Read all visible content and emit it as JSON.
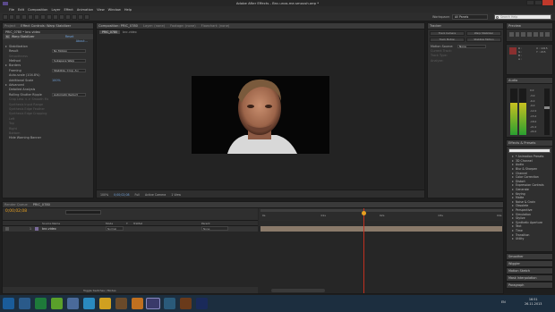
{
  "window": {
    "title": "Adobe After Effects - Bnc.unos.me.smoush.aep *"
  },
  "menu": [
    "File",
    "Edit",
    "Composition",
    "Layer",
    "Effect",
    "Animation",
    "View",
    "Window",
    "Help"
  ],
  "workspace": {
    "label": "Workspace:",
    "value": "All Panels",
    "search_placeholder": "Search Help"
  },
  "effect_controls": {
    "tab": "Effect Controls: Warp Stabilizer",
    "other_tab": "Project",
    "breadcrumb": "PRIC_0780 • bnc.video",
    "effect_name": "Warp Stabilizer",
    "reset": "Reset",
    "about": "About...",
    "rows": [
      {
        "label": "Stabilization",
        "value": "",
        "kind": "section"
      },
      {
        "label": "Result",
        "value": "No Motion",
        "kind": "dropdown"
      },
      {
        "label": "Smoothness",
        "value": "",
        "kind": "dim"
      },
      {
        "label": "Method",
        "value": "Subspace Warp",
        "kind": "dropdown"
      },
      {
        "label": "Borders",
        "value": "",
        "kind": "section"
      },
      {
        "label": "Framing",
        "value": "Stabilize, Crop, Au",
        "kind": "dropdown"
      },
      {
        "label": "Auto-scale (104.8%)",
        "value": "",
        "kind": "plain"
      },
      {
        "label": "Additional Scale",
        "value": "100%",
        "kind": "value"
      },
      {
        "label": "Advanced",
        "value": "",
        "kind": "section"
      },
      {
        "label": "Detailed Analysis",
        "value": "",
        "kind": "plain"
      },
      {
        "label": "Rolling Shutter Ripple",
        "value": "Automatic Reduct",
        "kind": "dropdown"
      },
      {
        "label": "Crop Less <-> Smooth More",
        "value": "",
        "kind": "dim"
      },
      {
        "label": "Synthesis Input Range",
        "value": "",
        "kind": "dim"
      },
      {
        "label": "Synthesis Edge Feather",
        "value": "",
        "kind": "dim"
      },
      {
        "label": "Synthesis Edge Cropping",
        "value": "",
        "kind": "dim"
      },
      {
        "label": "Left",
        "value": "",
        "kind": "dim"
      },
      {
        "label": "Top",
        "value": "",
        "kind": "dim"
      },
      {
        "label": "Right",
        "value": "",
        "kind": "dim"
      },
      {
        "label": "Bottom",
        "value": "",
        "kind": "dim"
      },
      {
        "label": "Hide Warning Banner",
        "value": "",
        "kind": "plain"
      }
    ]
  },
  "composition": {
    "tabs": [
      "Composition: PRIC_0780",
      "Layer: (none)",
      "Footage: (none)",
      "Flowchart: (none)"
    ],
    "subtabs": [
      "PRIC_0780",
      "bnc.video"
    ],
    "zoom": "100%",
    "timecode": "0;00;02;08",
    "resolution": "Full",
    "camera": "Active Camera",
    "view": "1 View"
  },
  "tracker": {
    "title": "Tracker",
    "motion_source_label": "Motion Source:",
    "motion_source": "None",
    "current_track_label": "Current Track:",
    "track_type_label": "Track Type:",
    "analyze_label": "Analyze:",
    "buttons": [
      "Track Camera",
      "Warp Stabilizer",
      "Track Motion",
      "Stabilize Motion"
    ]
  },
  "preview": {
    "title": "Preview"
  },
  "info": {
    "r": "R :",
    "g": "G :",
    "b": "B :",
    "a": "A :",
    "x": "X : 1015",
    "y": "Y : 215"
  },
  "audio": {
    "title": "Audio",
    "levels": [
      "0.0",
      "-3.0",
      "-6.0",
      "-9.0",
      "-12.0",
      "-15.0",
      "-18.0",
      "-21.0",
      "-24.0"
    ]
  },
  "effects_presets": {
    "title": "Effects & Presets",
    "search_placeholder": "",
    "items": [
      "* Animation Presets",
      "3D Channel",
      "Audio",
      "Blur & Sharpen",
      "Channel",
      "Color Correction",
      "Distort",
      "Expression Controls",
      "Generate",
      "Keying",
      "Matte",
      "Noise & Grain",
      "Obsolete",
      "Perspective",
      "Simulation",
      "Stylize",
      "Synthetic Aperture",
      "Text",
      "Time",
      "Transition",
      "Utility"
    ],
    "collapsed_panels": [
      "Smoother",
      "Wiggler",
      "Motion Sketch",
      "Mask Interpolation",
      "Paragraph"
    ]
  },
  "timeline": {
    "tabs": [
      "Render Queue",
      "PRIC_0780"
    ],
    "timecode": "0;00;02;08",
    "columns": [
      "Source Name",
      "Mode",
      "T",
      "TrkMat",
      "Parent"
    ],
    "layer": {
      "index": "1",
      "name": "bnc.video",
      "mode": "Normal",
      "parent": "None"
    },
    "ruler": [
      "0s",
      "01s",
      "02s",
      "03s",
      "04s"
    ],
    "footer": "Toggle Switches / Modes"
  },
  "taskbar": {
    "time": "16:51",
    "date": "26.11.2013",
    "lang": "EN"
  },
  "colors": {
    "accent": "#4a90d9",
    "playhead": "#e8a020",
    "layer_bar": "#8a7a6a",
    "taskbar": "#1c2e3f"
  }
}
